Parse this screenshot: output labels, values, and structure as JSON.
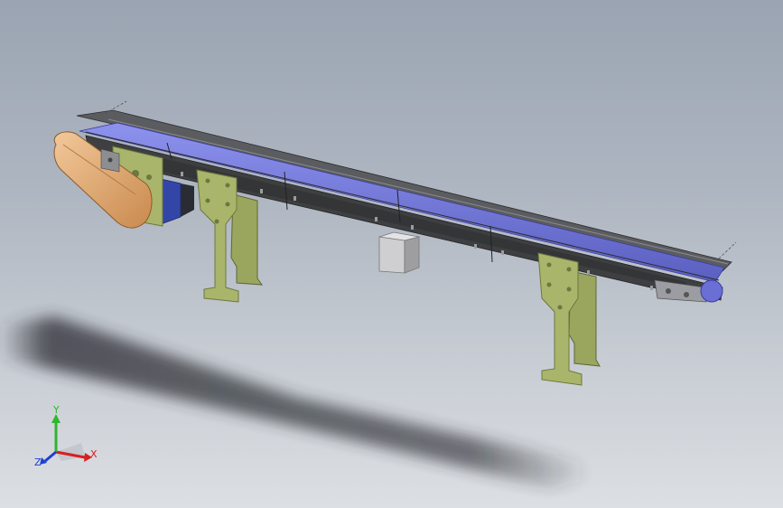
{
  "viewport": {
    "background_top": "#9aa4b2",
    "background_bottom": "#dcdfe3"
  },
  "model": {
    "colors": {
      "belt": "#7a7fe0",
      "belt_dark": "#5a5fc0",
      "frame": "#3e3f41",
      "frame_top": "#5a5c60",
      "legs": "#a9b56a",
      "leg_edge": "#6e7740",
      "motor": "#e8b27a",
      "gearbox": "#3346a8",
      "junction_box": "#b9b9bb",
      "shadow": "#2e3036"
    }
  },
  "triad": {
    "x_label": "X",
    "y_label": "Y",
    "z_label": "Z",
    "x_color": "#d62020",
    "y_color": "#2fb52f",
    "z_color": "#2040d0"
  }
}
